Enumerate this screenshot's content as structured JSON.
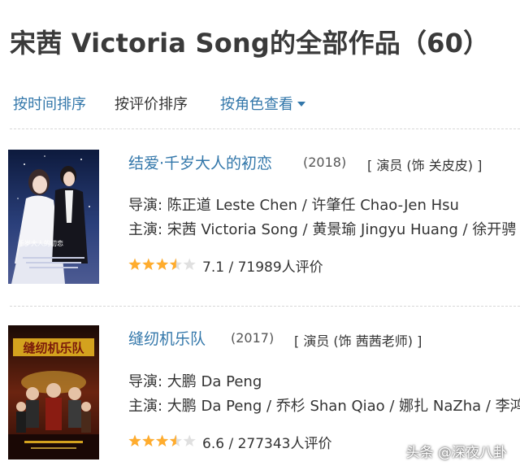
{
  "page": {
    "title": "宋茜 Victoria Song的全部作品（60）"
  },
  "sort": {
    "by_time": "按时间排序",
    "by_rating": "按评价排序",
    "by_role": "按角色查看"
  },
  "works": [
    {
      "title": "结爱·千岁大人的初恋",
      "year": "(2018)",
      "role": "[ 演员 (饰 关皮皮) ]",
      "director_line": "导演: 陈正道 Leste Chen / 许肇任 Chao-Jen Hsu",
      "cast_line": "主演: 宋茜 Victoria Song / 黄景瑜 Jingyu Huang / 徐开骋",
      "rating": 7.1,
      "rating_text": "7.1 / 71989人评价",
      "poster_caption": "千岁大人的初恋"
    },
    {
      "title": "缝纫机乐队",
      "year": "(2017)",
      "role": "[ 演员 (饰 茜茜老师) ]",
      "director_line": "导演: 大鹏 Da Peng",
      "cast_line": "主演: 大鹏 Da Peng / 乔杉 Shan Qiao / 娜扎 NaZha / 李鸿",
      "rating": 6.6,
      "rating_text": "6.6 / 277343人评价",
      "poster_caption": "缝纫机乐队"
    }
  ],
  "watermark": "头条 @深夜八卦",
  "colors": {
    "link": "#3377aa",
    "star": "#ffac2d",
    "star_empty": "#e0e0e0"
  }
}
